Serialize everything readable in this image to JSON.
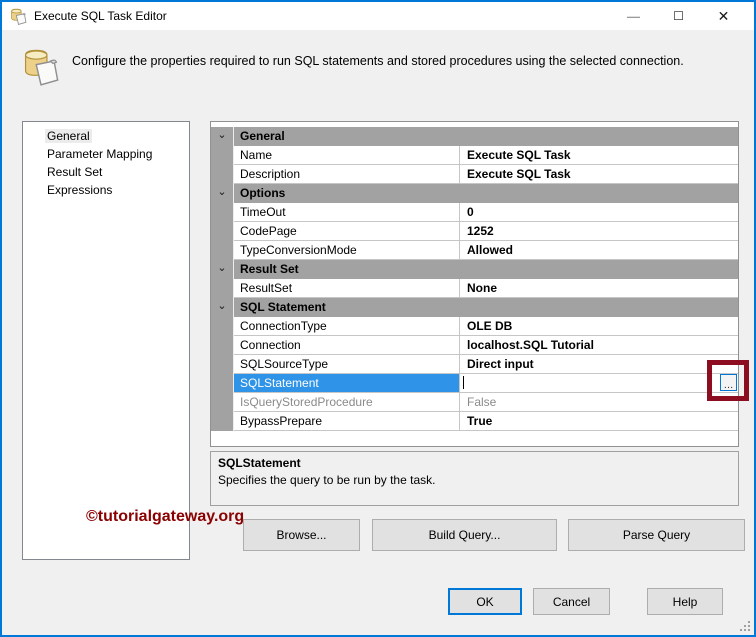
{
  "window": {
    "title": "Execute SQL Task Editor",
    "controls": {
      "minimize": "—",
      "maximize": "☐",
      "close": "✕"
    },
    "accent_color": "#0078d7"
  },
  "header": {
    "text": "Configure the properties required to run SQL statements and stored procedures using the selected connection."
  },
  "nav": {
    "items": [
      {
        "label": "General",
        "selected": true
      },
      {
        "label": "Parameter Mapping",
        "selected": false
      },
      {
        "label": "Result Set",
        "selected": false
      },
      {
        "label": "Expressions",
        "selected": false
      }
    ]
  },
  "property_grid": {
    "chevron": "⌄",
    "selected_color": "#2f93e8",
    "category_color": "#a2a2a2",
    "rows": [
      {
        "type": "category",
        "label": "General"
      },
      {
        "type": "property",
        "name": "Name",
        "value": "Execute SQL Task"
      },
      {
        "type": "property",
        "name": "Description",
        "value": "Execute SQL Task"
      },
      {
        "type": "category",
        "label": "Options"
      },
      {
        "type": "property",
        "name": "TimeOut",
        "value": "0"
      },
      {
        "type": "property",
        "name": "CodePage",
        "value": "1252"
      },
      {
        "type": "property",
        "name": "TypeConversionMode",
        "value": "Allowed"
      },
      {
        "type": "category",
        "label": "Result Set"
      },
      {
        "type": "property",
        "name": "ResultSet",
        "value": "None"
      },
      {
        "type": "category",
        "label": "SQL Statement"
      },
      {
        "type": "property",
        "name": "ConnectionType",
        "value": "OLE DB"
      },
      {
        "type": "property",
        "name": "Connection",
        "value": "localhost.SQL Tutorial"
      },
      {
        "type": "property",
        "name": "SQLSourceType",
        "value": "Direct input"
      },
      {
        "type": "property",
        "name": "SQLStatement",
        "value": "",
        "selected": true,
        "ellipsis": true
      },
      {
        "type": "property",
        "name": "IsQueryStoredProcedure",
        "value": "False",
        "disabled": true
      },
      {
        "type": "property",
        "name": "BypassPrepare",
        "value": "True"
      }
    ],
    "ellipsis_label": "…"
  },
  "description_panel": {
    "title": "SQLStatement",
    "text": "Specifies the query to be run by the task."
  },
  "watermark": {
    "text": "©tutorialgateway.org",
    "color": "#8b0000"
  },
  "action_buttons": [
    {
      "label": "Browse..."
    },
    {
      "label": "Build Query..."
    },
    {
      "label": "Parse Query"
    }
  ],
  "footer_buttons": [
    {
      "label": "OK",
      "default": true
    },
    {
      "label": "Cancel",
      "default": false
    },
    {
      "label": "Help",
      "default": false
    }
  ],
  "annotation": {
    "color": "#8c0d1f"
  }
}
